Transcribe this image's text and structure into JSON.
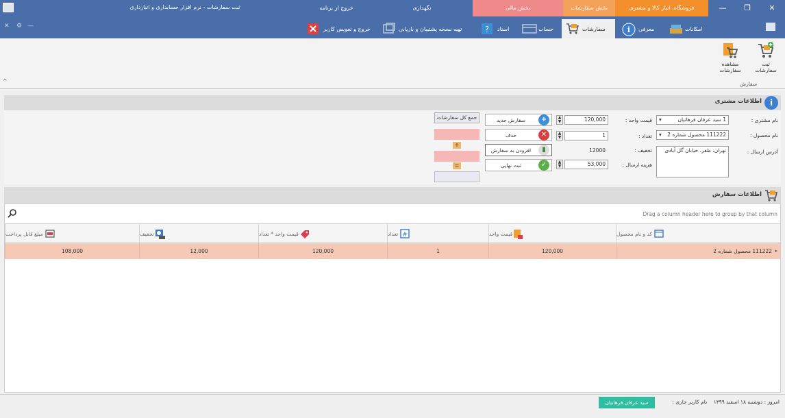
{
  "app": {
    "title": "ثبت سفارشات - نرم افزار حسابداری و انبارداری",
    "context_tabs": [
      {
        "label": "خروج از برنامه",
        "color": "#4a6ea9"
      },
      {
        "label": "نگهداری",
        "color": "#4a6ea9"
      },
      {
        "label": "بخش مالی",
        "color": "#f08a8a"
      },
      {
        "label": "بخش سفارشات",
        "color": "#f4a25a"
      },
      {
        "label": "فروشگاه، انبار کالا و مشتری",
        "color": "#f4902c"
      }
    ],
    "window_controls": {
      "close": "✕",
      "maximize": "❐",
      "minimize": "—"
    },
    "mini_controls": {
      "close": "✕",
      "settings": "⚙",
      "min": "—"
    },
    "ribbon_tabs": [
      {
        "label": "خروج و تعویض کاربر",
        "icon": "exit-icon"
      },
      {
        "label": "تهیه نسخه پشتیبان و بازیابی",
        "icon": "backup-icon"
      },
      {
        "label": "اسناد",
        "icon": "help-icon"
      },
      {
        "label": "حساب",
        "icon": "account-icon"
      },
      {
        "label": "سفارشات",
        "icon": "cart-icon"
      },
      {
        "label": "معرفی",
        "icon": "info-icon"
      },
      {
        "label": "امکانات",
        "icon": "tools-icon"
      }
    ],
    "active_tab": "سفارشات"
  },
  "ribbon": {
    "buttons": [
      {
        "label": "ثبت سفارشات",
        "icon": "add-cart-icon"
      },
      {
        "label": "مشاهده سفارشات",
        "icon": "view-cart-icon"
      }
    ],
    "group_label": "سفارش"
  },
  "customer_panel": {
    "title": "اطلاعات مشتری",
    "labels": {
      "customer_name": "نام مشتری :",
      "product_name": "نام محصول :",
      "address": "آدرس ارسال :",
      "unit_price": "قیمت واحد :",
      "quantity": "تعداد :",
      "discount": "تخفیف :",
      "shipping": "هزینه ارسال :"
    },
    "values": {
      "customer_name": "1 سید عرفان فرهانیان",
      "product_name": "111222 محصول شماره 2",
      "address": "تهران، ظفر، خیابان گل آبادی",
      "unit_price": "120,000",
      "quantity": "1",
      "discount": "12000",
      "shipping": "53,000"
    },
    "actions": {
      "new_order": "سفارش جدید",
      "delete": "حذف",
      "add_to_order": "افزودن به سفارش",
      "final_submit": "ثبت نهایی"
    },
    "totals_label": "جمع کل سفارشات",
    "plus": "+",
    "equals": "="
  },
  "orders_panel": {
    "title": "اطلاعات سفارش",
    "group_hint": "Drag a column header here to group by that column",
    "columns": [
      {
        "label": "کد و نام محصول",
        "icon": "product-icon"
      },
      {
        "label": "قیمت واحد",
        "icon": "price-tag-icon"
      },
      {
        "label": "تعداد",
        "icon": "hash-icon"
      },
      {
        "label": "قیمت واحد * تعداد",
        "icon": "tag-icon"
      },
      {
        "label": "تخفیف",
        "icon": "discount-icon"
      },
      {
        "label": "مبلغ قابل پرداخت",
        "icon": "payable-icon"
      }
    ],
    "rows": [
      {
        "product": "111222 محصول شماره 2",
        "unit_price": "120,000",
        "qty": "1",
        "subtotal": "120,000",
        "discount": "12,000",
        "payable": "108,000"
      }
    ]
  },
  "status": {
    "today": "امروز : دوشنبه ۱۸ اسفند ۱۳۹۹",
    "user_label": "نام کاربر جاری :",
    "user": "سید عرفان فرهانیان"
  },
  "colors": {
    "title_bar": "#4a6ea9",
    "row_highlight": "#f6c9b6",
    "accent_orange": "#f4902c",
    "accent_pink": "#f08a8a",
    "user_badge": "#2fbfa0"
  }
}
